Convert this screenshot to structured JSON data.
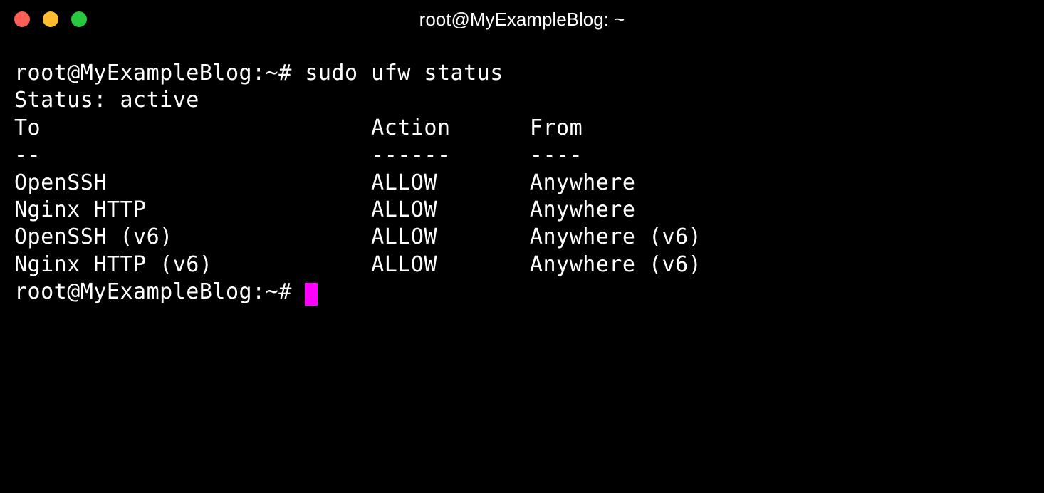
{
  "window": {
    "title": "root@MyExampleBlog: ~"
  },
  "terminal": {
    "prompt1": "root@MyExampleBlog:~# ",
    "command1": "sudo ufw status",
    "status_line": "Status: active",
    "blank": "",
    "header": {
      "to": "To",
      "action": "Action",
      "from": "From"
    },
    "separator": {
      "to": "--",
      "action": "------",
      "from": "----"
    },
    "rules": [
      {
        "to": "OpenSSH",
        "action": "ALLOW",
        "from": "Anywhere"
      },
      {
        "to": "Nginx HTTP",
        "action": "ALLOW",
        "from": "Anywhere"
      },
      {
        "to": "OpenSSH (v6)",
        "action": "ALLOW",
        "from": "Anywhere (v6)"
      },
      {
        "to": "Nginx HTTP (v6)",
        "action": "ALLOW",
        "from": "Anywhere (v6)"
      }
    ],
    "prompt2": "root@MyExampleBlog:~# "
  },
  "columns": {
    "to_width": 27,
    "action_width": 12
  }
}
